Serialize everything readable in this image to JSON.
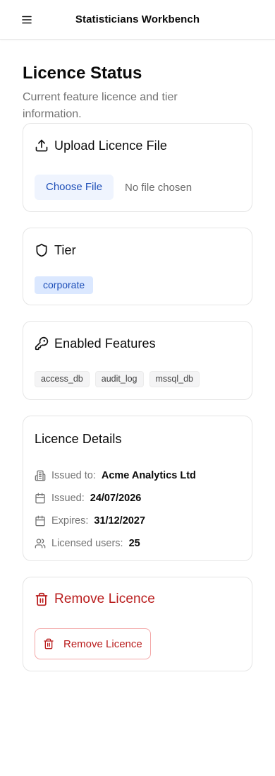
{
  "header": {
    "app_title": "Statisticians Workbench",
    "menu_icon": "hamburger-menu-icon"
  },
  "page": {
    "title": "Licence Status",
    "subtitle": "Current feature licence and tier information."
  },
  "upload": {
    "title": "Upload Licence File",
    "icon": "upload-icon",
    "choose_label": "Choose File",
    "status": "No file chosen"
  },
  "tier": {
    "title": "Tier",
    "icon": "shield-icon",
    "value": "corporate"
  },
  "features": {
    "title": "Enabled Features",
    "icon": "key-icon",
    "items": [
      "access_db",
      "audit_log",
      "mssql_db"
    ]
  },
  "details": {
    "title": "Licence Details",
    "items": [
      {
        "icon": "building-icon",
        "label": "Issued to:",
        "value": "Acme Analytics Ltd"
      },
      {
        "icon": "calendar-icon",
        "label": "Issued:",
        "value": "24/07/2026"
      },
      {
        "icon": "calendar-icon",
        "label": "Expires:",
        "value": "31/12/2027"
      },
      {
        "icon": "users-icon",
        "label": "Licensed users:",
        "value": "25"
      }
    ]
  },
  "remove": {
    "title": "Remove Licence",
    "icon": "trash-icon",
    "button_label": "Remove Licence"
  },
  "colors": {
    "accent_blue": "#1e4fb8",
    "badge_bg": "#dbe8ff",
    "danger": "#b91c1c",
    "border": "#e5e5e5",
    "muted_text": "#737373"
  }
}
